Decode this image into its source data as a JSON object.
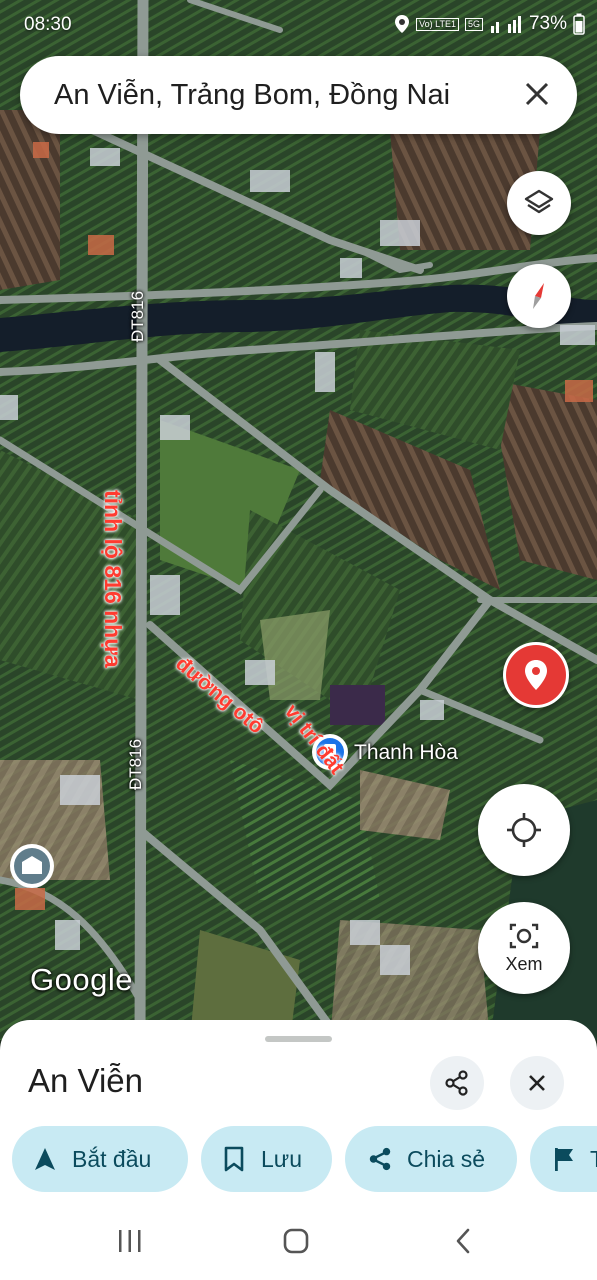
{
  "status_bar": {
    "time": "08:30",
    "network": "Vo) LTE1",
    "signal_type": "5G",
    "battery": "73%"
  },
  "search": {
    "query": "An Viễn, Trảng Bom, Đồng Nai"
  },
  "map": {
    "road_labels": [
      "ĐT816",
      "ĐT816"
    ],
    "annotations": {
      "provincial_road": "tỉnh lộ 816 nhựa",
      "car_road": "đường otô",
      "land_location": "vị trí đất"
    },
    "place_label": "Thanh Hòa",
    "logo": "Google",
    "lens_label": "Xem",
    "colors": {
      "pin_red": "#e53935",
      "annotation_red": "#ff3b30",
      "compass_red": "#e53935",
      "poi_blue": "#1a73e8"
    }
  },
  "sheet": {
    "title": "An Viễn",
    "chips": [
      {
        "label": "Bắt đầu",
        "icon": "navigation-arrow-icon"
      },
      {
        "label": "Lưu",
        "icon": "bookmark-icon"
      },
      {
        "label": "Chia sẻ",
        "icon": "share-icon"
      },
      {
        "label": "T",
        "icon": "flag-icon"
      }
    ],
    "chip_color": "#c8eaf3",
    "chip_text_color": "#0b4b5d"
  }
}
